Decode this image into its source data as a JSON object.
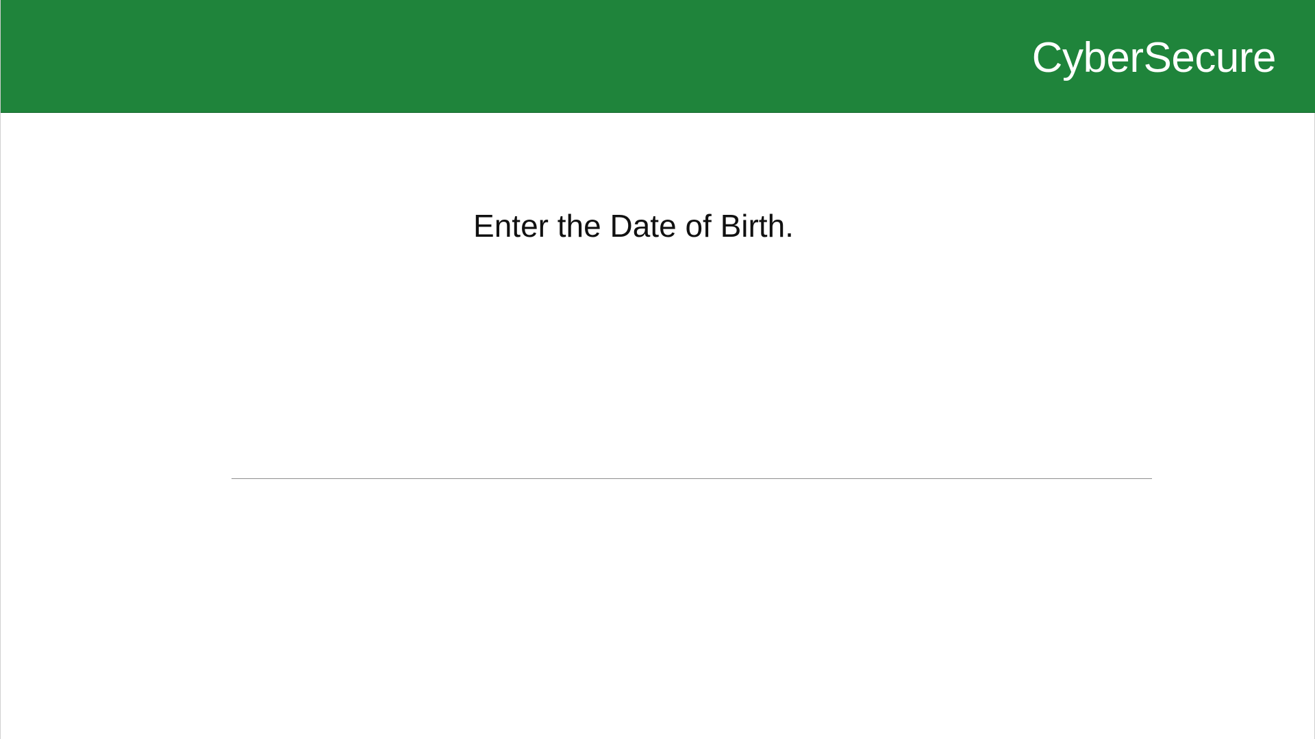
{
  "app": {
    "brand_name": "CyberSecure",
    "brand_color": "#1f843b"
  },
  "main": {
    "prompt": "Enter the Date of Birth.",
    "dob_input": {
      "value": "",
      "placeholder": ""
    }
  }
}
